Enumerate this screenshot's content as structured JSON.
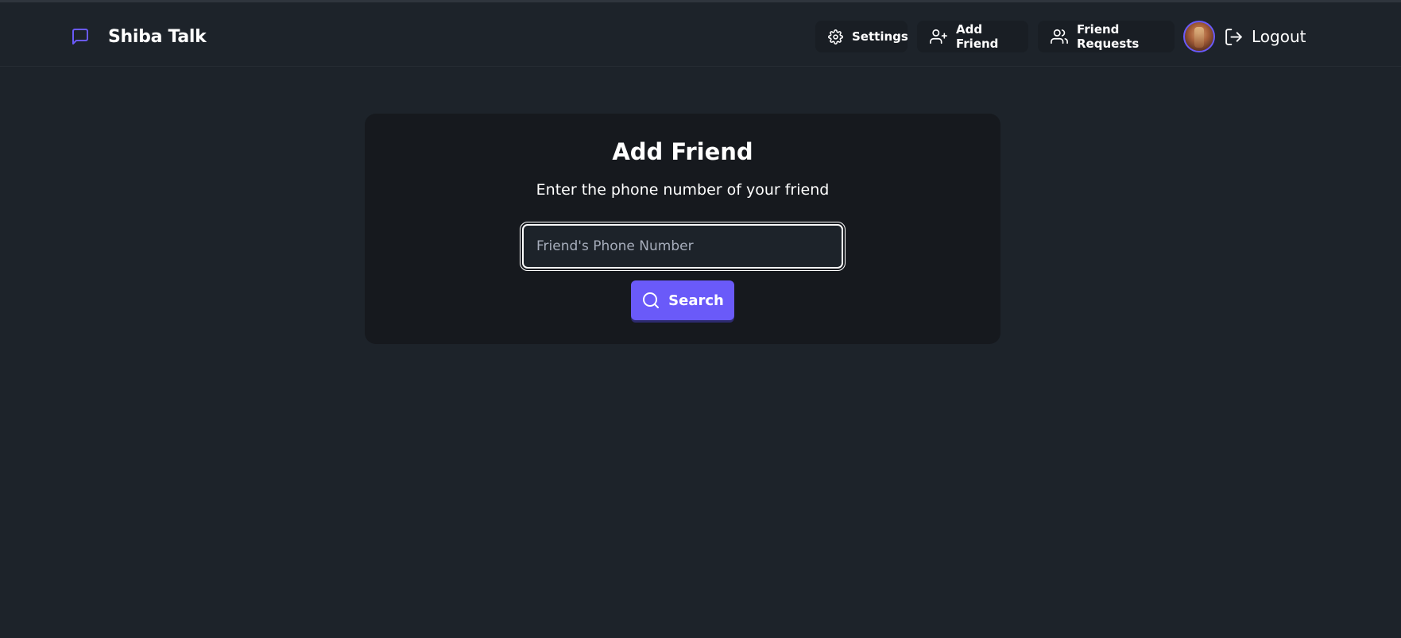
{
  "app": {
    "title": "Shiba Talk",
    "logo_icon": "message-square-icon",
    "accent_color": "#6a5af9",
    "background_color": "#1d232a"
  },
  "nav": {
    "settings": {
      "label": "Settings",
      "icon": "gear-icon"
    },
    "add_friend": {
      "label": "Add Friend",
      "icon": "user-plus-icon"
    },
    "friend_requests": {
      "label": "Friend Requests",
      "icon": "users-icon"
    },
    "avatar": {
      "icon": "avatar"
    },
    "logout": {
      "label": "Logout",
      "icon": "log-out-icon"
    }
  },
  "add_friend_card": {
    "title": "Add Friend",
    "subtitle": "Enter the phone number of your friend",
    "phone_input": {
      "placeholder": "Friend's Phone Number",
      "value": ""
    },
    "search_button": {
      "label": "Search",
      "icon": "search-icon"
    }
  }
}
